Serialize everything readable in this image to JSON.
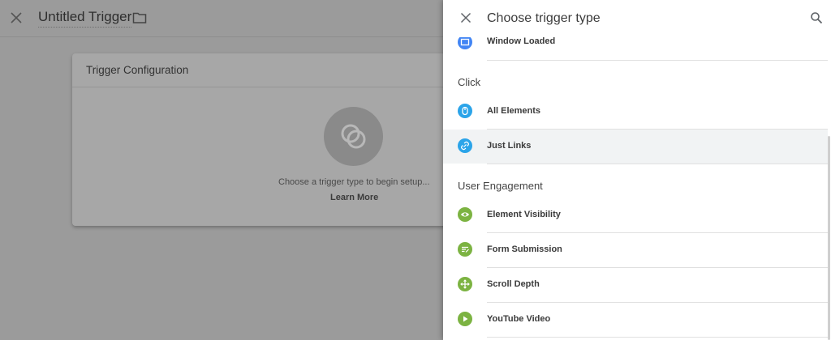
{
  "background": {
    "trigger_name": "Untitled Trigger",
    "config_card": {
      "title": "Trigger Configuration",
      "prompt": "Choose a trigger type to begin setup...",
      "learn_more": "Learn More"
    }
  },
  "drawer": {
    "title": "Choose trigger type",
    "items": [
      {
        "label": "Window Loaded",
        "icon": "window-icon",
        "color": "#4285f4"
      }
    ],
    "sections": [
      {
        "label": "Click",
        "items": [
          {
            "label": "All Elements",
            "icon": "mouse-icon",
            "color": "#2ba4e9"
          },
          {
            "label": "Just Links",
            "icon": "link-icon",
            "color": "#2ba4e9",
            "selected": true
          }
        ]
      },
      {
        "label": "User Engagement",
        "items": [
          {
            "label": "Element Visibility",
            "icon": "eye-icon",
            "color": "#7cb342"
          },
          {
            "label": "Form Submission",
            "icon": "form-icon",
            "color": "#7cb342"
          },
          {
            "label": "Scroll Depth",
            "icon": "scroll-move-icon",
            "color": "#7cb342"
          },
          {
            "label": "YouTube Video",
            "icon": "play-icon",
            "color": "#7cb342"
          }
        ]
      }
    ]
  }
}
